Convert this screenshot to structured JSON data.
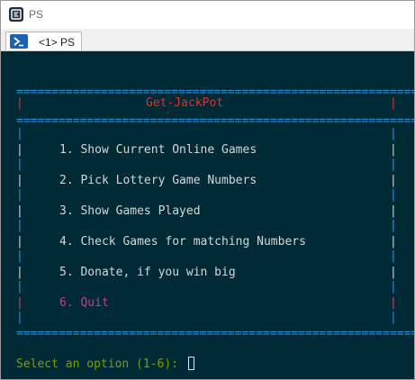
{
  "window": {
    "title": "PS",
    "tab_label": "<1> PS"
  },
  "console": {
    "separator": "==========================================================",
    "banner_title": "Get-JackPot",
    "side_bar_char": "|",
    "menu_items": [
      {
        "label": "1. Show Current Online Games",
        "color": "#d6d6d6"
      },
      {
        "label": "2. Pick Lottery Game Numbers",
        "color": "#d6d6d6"
      },
      {
        "label": "3. Show Games Played",
        "color": "#d6d6d6"
      },
      {
        "label": "4. Check Games for matching Numbers",
        "color": "#d6d6d6"
      },
      {
        "label": "5. Donate, if you win big",
        "color": "#d6d6d6"
      },
      {
        "label": "6. Quit",
        "color": "#d33682"
      }
    ],
    "prompt": "Select an option (1-6): "
  },
  "colors": {
    "console_background": "#002b36",
    "border": "#2d8fd4",
    "title_red": "#dc322f",
    "quit_magenta": "#d33682",
    "prompt_green": "#859900"
  },
  "icons": {
    "app": "console-icon",
    "tab": "powershell-icon"
  }
}
